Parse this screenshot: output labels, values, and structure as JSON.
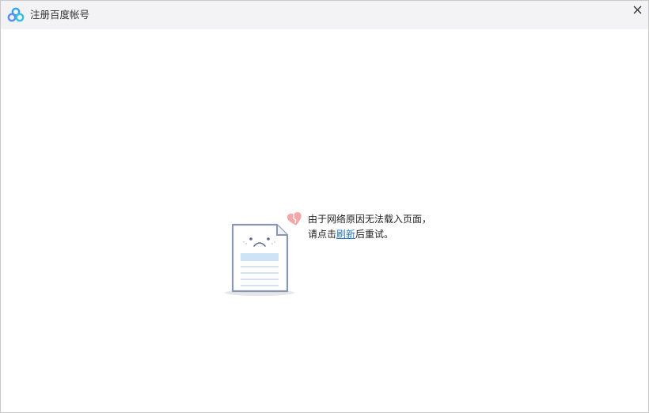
{
  "window": {
    "title": "注册百度帐号",
    "logo_icon": "baidu-cloud-logo",
    "close_icon": "close-icon"
  },
  "error": {
    "illustration": "sad-document-icon",
    "line1": "由于网络原因无法载入页面，",
    "line2_prefix": "请点击",
    "refresh_label": "刷新",
    "line2_suffix": "后重试。"
  },
  "colors": {
    "titlebar_bg": "#f3f3f5",
    "link": "#2b78c2",
    "document_outline": "#8a97b3",
    "highlight_bar": "#cfe3f7",
    "heart": "#f4a7a7"
  }
}
